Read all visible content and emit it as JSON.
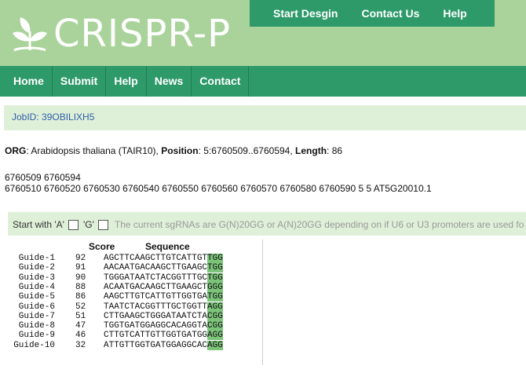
{
  "brand": {
    "name": "CRISPR-P"
  },
  "topnav": [
    {
      "label": "Start Desgin"
    },
    {
      "label": "Contact Us"
    },
    {
      "label": "Help"
    }
  ],
  "mainnav": [
    {
      "label": "Home"
    },
    {
      "label": "Submit"
    },
    {
      "label": "Help"
    },
    {
      "label": "News"
    },
    {
      "label": "Contact"
    }
  ],
  "job": {
    "label": "JobID: 39OBILIXH5"
  },
  "org": {
    "org_label": "ORG",
    "org_value": ": Arabidopsis thaliana (TAIR10),",
    "pos_label": "Position",
    "pos_value": ": 5:6760509..6760594,",
    "len_label": "Length",
    "len_value": ": 86"
  },
  "coords": {
    "line1": "6760509 6760594",
    "line2": "6760510 6760520 6760530 6760540 6760550 6760560 6760570 6760580 6760590 5 5 AT5G20010.1"
  },
  "start_with": {
    "label": "Start with 'A'",
    "g_label": "'G'",
    "note": "The current sgRNAs are G(N)20GG or A(N)20GG depending on if U6 or U3 promoters are used fo"
  },
  "table": {
    "score_header": "Score",
    "sequence_header": "Sequence",
    "rows": [
      {
        "guide": "Guide-1",
        "score": "92",
        "seq": "AGCTTCAAGCTTGTCATTGT",
        "pam": "TGG"
      },
      {
        "guide": "Guide-2",
        "score": "91",
        "seq": "AACAATGACAAGCTTGAAGC",
        "pam": "TGG"
      },
      {
        "guide": "Guide-3",
        "score": "90",
        "seq": "TGGGATAATCTACGGTTTGC",
        "pam": "TGG"
      },
      {
        "guide": "Guide-4",
        "score": "88",
        "seq": "ACAATGACAAGCTTGAAGCT",
        "pam": "GGG"
      },
      {
        "guide": "Guide-5",
        "score": "86",
        "seq": "AAGCTTGTCATTGTTGGTGA",
        "pam": "TGG"
      },
      {
        "guide": "Guide-6",
        "score": "52",
        "seq": "TAATCTACGGTTTGCTGGTT",
        "pam": "AGG"
      },
      {
        "guide": "Guide-7",
        "score": "51",
        "seq": "CTTGAAGCTGGGATAATCTA",
        "pam": "CGG"
      },
      {
        "guide": "Guide-8",
        "score": "47",
        "seq": "TGGTGATGGAGGCACAGGTA",
        "pam": "CGG"
      },
      {
        "guide": "Guide-9",
        "score": "46",
        "seq": "CTTGTCATTGTTGGTGATGG",
        "pam": "AGG"
      },
      {
        "guide": "Guide-10",
        "score": "32",
        "seq": "ATTGTTGGTGATGGAGGCAC",
        "pam": "AGG"
      }
    ]
  }
}
